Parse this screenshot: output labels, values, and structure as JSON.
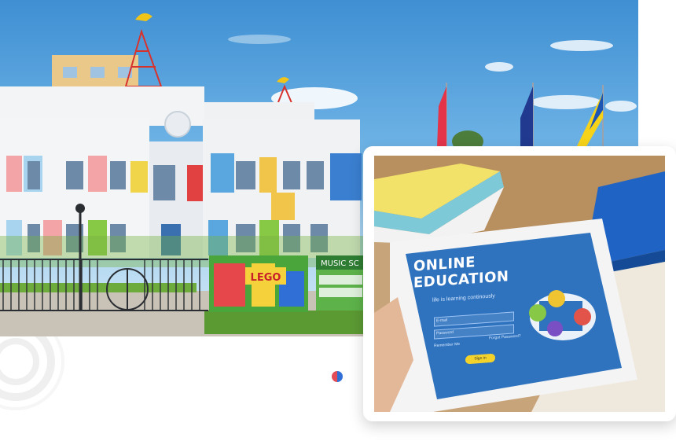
{
  "colors": {
    "accent_red": "#e44c57",
    "accent_blue": "#2f6fd6"
  },
  "banners": {
    "lego": "LEGO",
    "music": "MUSIC SC"
  },
  "tablet": {
    "title": "ONLINE EDUCATION",
    "subtitle": "life is learning continously",
    "email_placeholder": "E-mail",
    "password_placeholder": "Password",
    "remember": "Remember Me",
    "forgot": "Forgot Password?",
    "signin": "Sign in"
  }
}
